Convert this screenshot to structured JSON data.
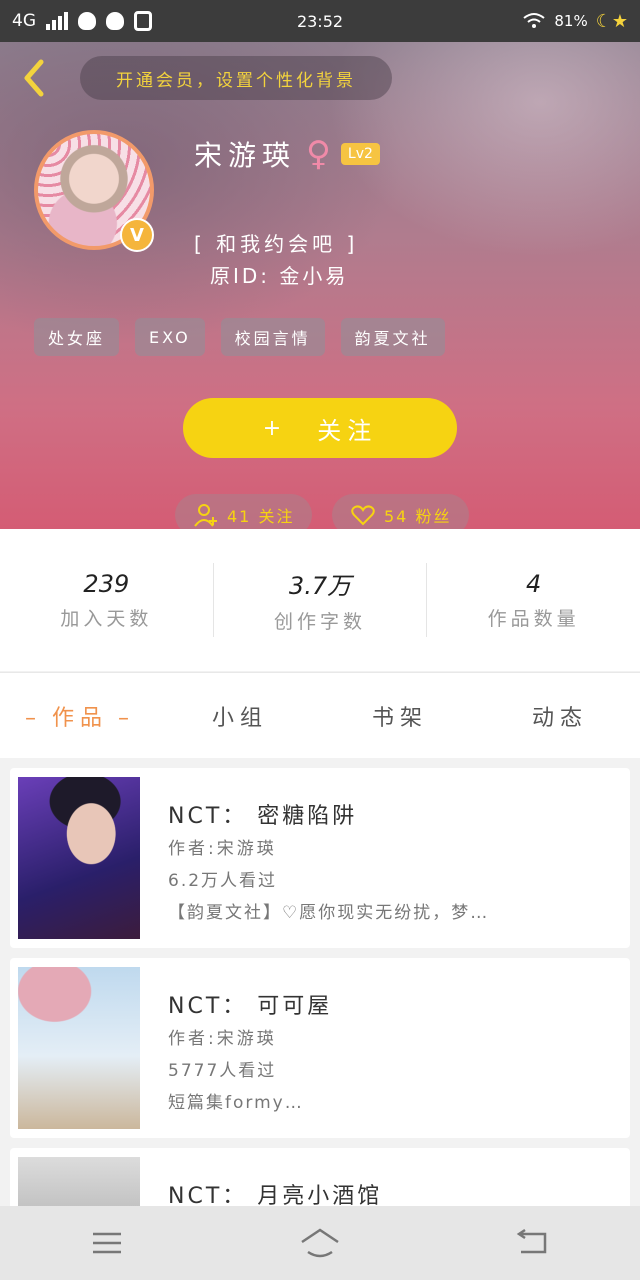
{
  "status_bar": {
    "network": "4G",
    "time": "23:52",
    "battery": "81%"
  },
  "header": {
    "bg_tip": "开通会员，设置个性化背景",
    "username": "宋游瑛",
    "gender_icon": "female-icon",
    "level": "Lv2",
    "vip_badge": "V",
    "signature": "[ 和我约会吧 ]",
    "original_id": "原ID: 金小易",
    "tags": [
      "处女座",
      "EXO",
      "校园言情",
      "韵夏文社"
    ],
    "follow_label": "关注",
    "following": "41 关注",
    "fans": "54 粉丝"
  },
  "stats": [
    {
      "value": "239",
      "label": "加入天数"
    },
    {
      "value": "3.7万",
      "label": "创作字数"
    },
    {
      "value": "4",
      "label": "作品数量"
    }
  ],
  "tabs": [
    "作品",
    "小组",
    "书架",
    "动态"
  ],
  "works": [
    {
      "title": "NCT： 密糖陷阱",
      "author": "作者:宋游瑛",
      "views": "6.2万人看过",
      "desc": "【韵夏文社】♡愿你现实无纷扰，梦…"
    },
    {
      "title": "NCT： 可可屋",
      "author": "作者:宋游瑛",
      "views": "5777人看过",
      "desc": "短篇集formy…"
    },
    {
      "title": "NCT： 月亮小酒馆",
      "author": "",
      "views": "",
      "desc": ""
    }
  ],
  "colors": {
    "accent_yellow": "#f6d312",
    "tab_active": "#f0924c"
  }
}
